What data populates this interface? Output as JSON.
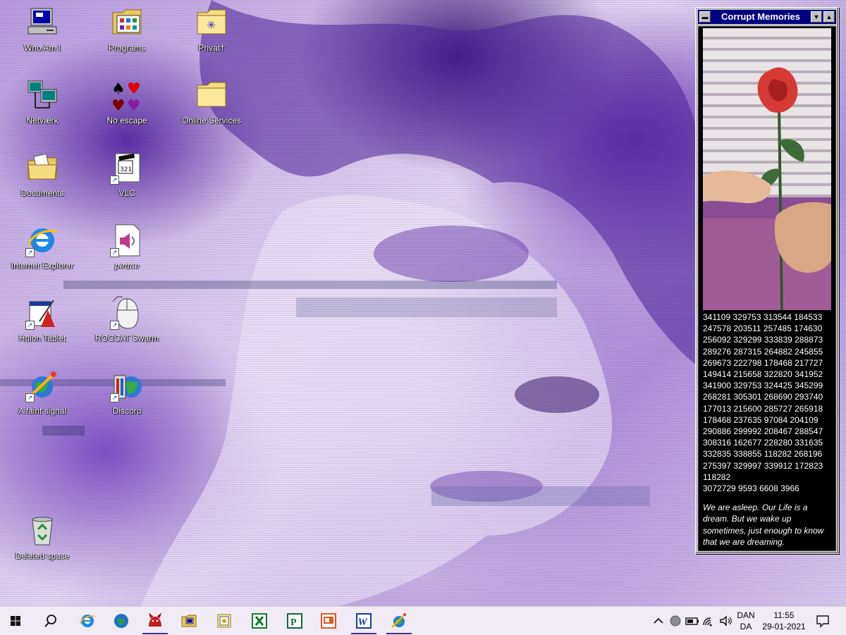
{
  "desktop": {
    "icons": [
      {
        "label": "Who Am I",
        "name": "who-am-i-icon"
      },
      {
        "label": "Programs",
        "name": "programs-folder-icon"
      },
      {
        "label": "Privat†",
        "name": "privat-folder-icon"
      },
      {
        "label": "Netværk",
        "name": "network-icon"
      },
      {
        "label": "No escape",
        "name": "card-suits-icon"
      },
      {
        "label": "Online Services",
        "name": "online-services-folder-icon"
      },
      {
        "label": "Documents",
        "name": "documents-folder-icon"
      },
      {
        "label": "VLC",
        "name": "vlc-clapper-icon"
      },
      {
        "label": "Internet Explorer",
        "name": "internet-explorer-icon"
      },
      {
        "label": "peace",
        "name": "sound-file-icon"
      },
      {
        "label": "Huion Tablet",
        "name": "huion-tablet-icon"
      },
      {
        "label": "ROCCAT Swarm",
        "name": "mouse-icon"
      },
      {
        "label": "A faint signal",
        "name": "faint-signal-globe-icon"
      },
      {
        "label": "Discord",
        "name": "discord-app-icon"
      },
      {
        "label": "Deleted space",
        "name": "recycle-bin-icon"
      }
    ]
  },
  "window": {
    "title": "Corrupt Memories",
    "numbers": [
      "341109 329753 313544 184533",
      "247578 203511 257485 174630",
      "256092 329299 333839 288873",
      "289276 287315 264882 245855",
      "269673 222798 178468 217727",
      "149414 215658 322820 341952",
      "341900 329753 324425 345299",
      "268281 305301 268690 293740",
      "177013 215600 285727 265918",
      "178468 237635 97084 204109",
      "290886 299992 208467 288547",
      "308316 162677 228280 331635",
      "332835 338855 118282 268196",
      "275397 329997 339912 172823",
      "118282",
      "3072729 9593 6608 3966"
    ],
    "quote": "We are asleep. Our Life is a dream. But we wake up sometimes, just enough to know that we are dreaming."
  },
  "taskbar": {
    "apps": [
      {
        "name": "start-windows-icon",
        "running": false
      },
      {
        "name": "search-icon",
        "running": false
      },
      {
        "name": "internet-explorer-taskbar-icon",
        "running": false
      },
      {
        "name": "globe-taskbar-icon",
        "running": false
      },
      {
        "name": "red-creature-taskbar-icon",
        "running": true
      },
      {
        "name": "computer-taskbar-icon",
        "running": false
      },
      {
        "name": "publisher-taskbar-icon",
        "running": false
      },
      {
        "name": "excel-taskbar-icon",
        "running": false
      },
      {
        "name": "project-taskbar-icon",
        "running": false
      },
      {
        "name": "powerpoint-taskbar-icon",
        "running": false
      },
      {
        "name": "word-taskbar-icon",
        "running": true
      },
      {
        "name": "faint-signal-taskbar-icon",
        "running": true
      }
    ],
    "tray": {
      "language_top": "DAN",
      "language_bottom": "DA",
      "time": "11:55",
      "date": "29-01-2021"
    }
  },
  "colors": {
    "window_titlebar": "#000080",
    "window_body": "#000000",
    "taskbar": "#f0ebf5",
    "wallpaper_accent": "#6a3ab5"
  }
}
